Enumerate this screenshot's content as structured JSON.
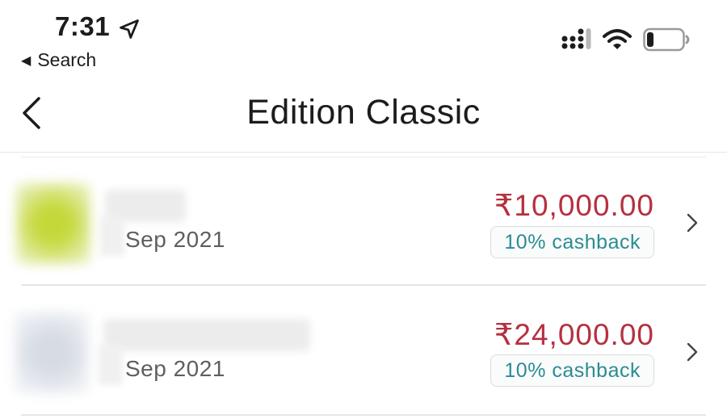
{
  "status_bar": {
    "time": "7:31",
    "back_app_label": "Search"
  },
  "nav": {
    "title": "Edition Classic"
  },
  "transactions": [
    {
      "date": "Sep 2021",
      "amount": "₹10,000.00",
      "cashback": "10% cashback",
      "thumb_color": "#c8d84a"
    },
    {
      "date": "Sep 2021",
      "amount": "₹24,000.00",
      "cashback": "10% cashback",
      "thumb_color": "#dfe3ea"
    }
  ],
  "colors": {
    "amount": "#b6303f",
    "cashback_text": "#2b8c93",
    "divider": "#e6e6e6"
  },
  "icons": {
    "location": "location-arrow-icon",
    "signal": "cellular-signal-icon",
    "wifi": "wifi-icon",
    "battery": "battery-low-icon",
    "back": "chevron-left-icon",
    "row": "chevron-right-icon"
  }
}
